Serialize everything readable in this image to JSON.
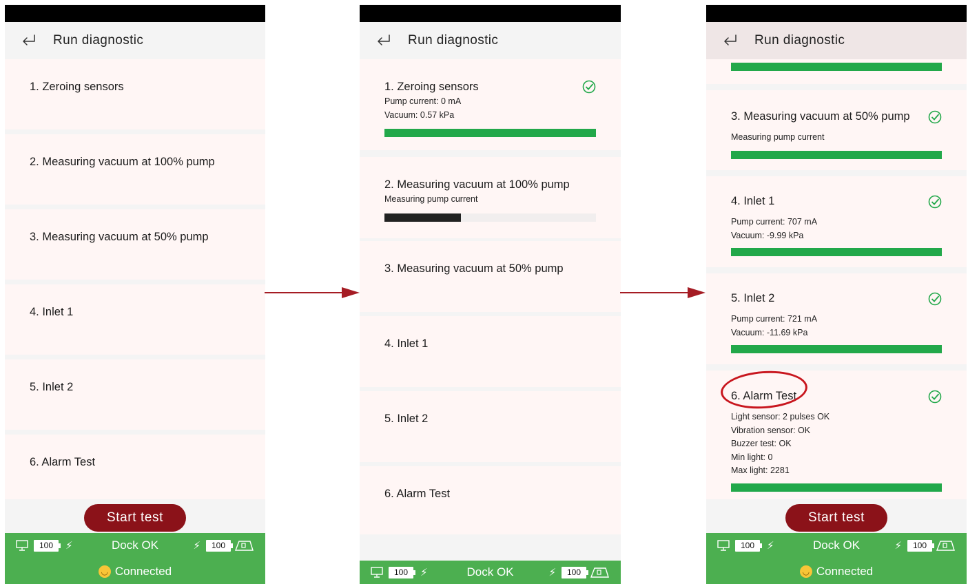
{
  "screens": [
    {
      "title": "Run diagnostic",
      "steps": [
        {
          "name": "1. Zeroing sensors"
        },
        {
          "name": "2. Measuring vacuum at 100% pump"
        },
        {
          "name": "3. Measuring vacuum at 50% pump"
        },
        {
          "name": "4. Inlet 1"
        },
        {
          "name": "5. Inlet 2"
        },
        {
          "name": "6. Alarm Test"
        }
      ],
      "start_label": "Start test",
      "footer": {
        "display_batt": "100",
        "dock_status": "Dock OK",
        "robot_batt": "100",
        "connection": "Connected"
      }
    },
    {
      "title": "Run diagnostic",
      "steps": [
        {
          "name": "1. Zeroing sensors",
          "details": [
            "Pump current: 0 mA",
            "Vacuum: 0.57 kPa"
          ],
          "progress": 1.0,
          "complete": true
        },
        {
          "name": "2. Measuring vacuum at 100% pump",
          "details": [
            "Measuring pump current"
          ],
          "progress": 0.36,
          "complete": false
        },
        {
          "name": "3. Measuring vacuum at 50% pump"
        },
        {
          "name": "4. Inlet 1"
        },
        {
          "name": "5. Inlet 2"
        },
        {
          "name": "6. Alarm Test"
        }
      ],
      "footer": {
        "display_batt": "100",
        "dock_status": "Dock OK",
        "robot_batt": "100"
      }
    },
    {
      "title": "Run diagnostic",
      "steps": [
        {
          "name": "",
          "progress": 1.0
        },
        {
          "name": "3. Measuring vacuum at 50% pump",
          "details": [
            "Measuring pump current"
          ],
          "progress": 1.0,
          "complete": true
        },
        {
          "name": "4. Inlet 1",
          "details": [
            "Pump current: 707 mA",
            "Vacuum: -9.99 kPa"
          ],
          "progress": 1.0,
          "complete": true
        },
        {
          "name": "5. Inlet 2",
          "details": [
            "Pump current: 721 mA",
            "Vacuum: -11.69 kPa"
          ],
          "progress": 1.0,
          "complete": true
        },
        {
          "name": "6. Alarm Test",
          "details": [
            "Light sensor: 2 pulses OK",
            "Vibration sensor: OK",
            "Buzzer test: OK",
            "Min light: 0",
            "Max light: 2281"
          ],
          "progress": 1.0,
          "complete": true
        }
      ],
      "start_label": "Start test",
      "footer": {
        "display_batt": "100",
        "dock_status": "Dock OK",
        "robot_batt": "100",
        "connection": "Connected"
      }
    }
  ],
  "colors": {
    "accent": "#8b1219",
    "success": "#22a84a",
    "footer": "#4caf50",
    "card": "#fff6f5",
    "annotation": "#c8161e",
    "arrow": "#a51c24"
  },
  "icons": {
    "back": "return-arrow-icon",
    "check": "check-circle-icon",
    "display": "monitor-icon",
    "charge": "bolt-icon",
    "robot": "robot-icon",
    "status": "smile-icon"
  }
}
